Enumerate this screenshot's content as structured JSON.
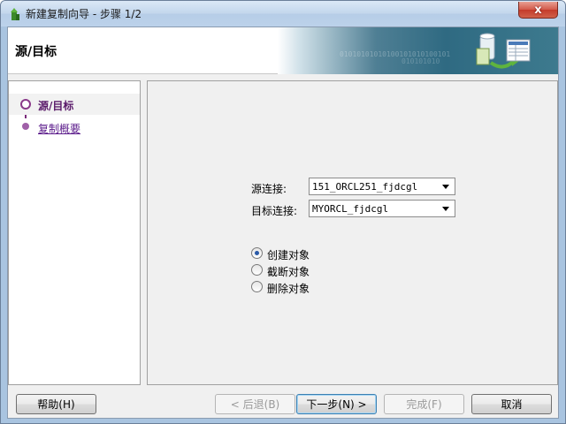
{
  "window": {
    "title": "新建复制向导 - 步骤 1/2",
    "close_glyph": "x"
  },
  "header": {
    "title": "源/目标",
    "banner_bits_1": "01010101010100101010100101",
    "banner_bits_2": "010101010"
  },
  "nav": {
    "items": [
      {
        "label": "源/目标",
        "active": true
      },
      {
        "label": "复制概要",
        "active": false
      }
    ]
  },
  "form": {
    "source_label": "源连接:",
    "source_value": "151_ORCL251_fjdcgl",
    "target_label": "目标连接:",
    "target_value": "MYORCL_fjdcgl",
    "options": [
      {
        "label": "创建对象",
        "checked": true
      },
      {
        "label": "截断对象",
        "checked": false
      },
      {
        "label": "删除对象",
        "checked": false
      }
    ]
  },
  "buttons": {
    "help": "帮助(H)",
    "back": "< 后退(B)",
    "next": "下一步(N) >",
    "finish": "完成(F)",
    "cancel": "取消"
  }
}
